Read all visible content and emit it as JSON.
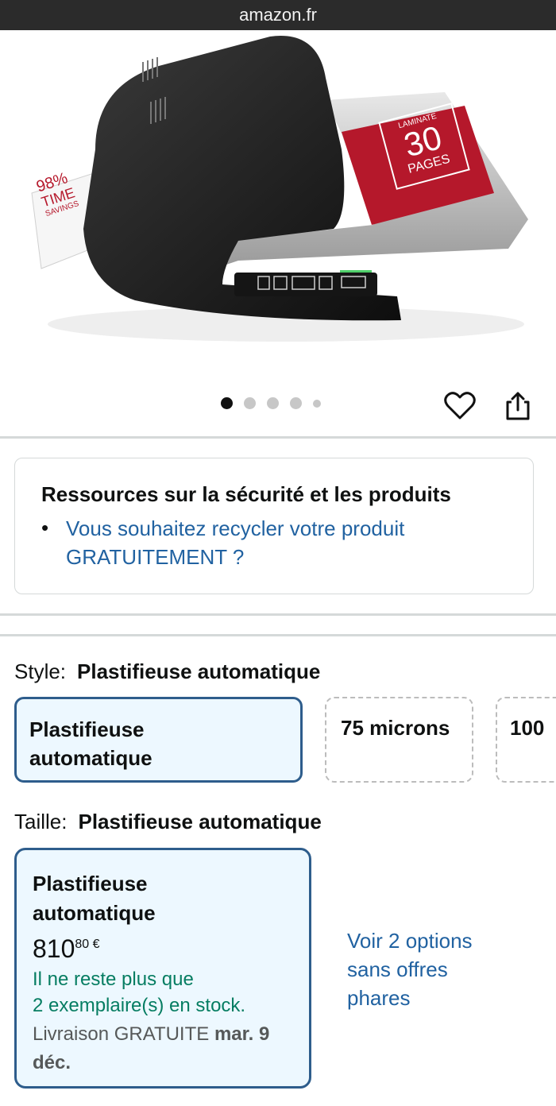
{
  "browser": {
    "url": "amazon.fr"
  },
  "product_image": {
    "badge_left": [
      "98%",
      "TIME",
      "SAVINGS"
    ],
    "badge_right": {
      "top": "LAMINATE",
      "number": "30",
      "bottom": "PAGES"
    },
    "carousel_dots": 5,
    "active_dot": 1
  },
  "actions": {
    "favorite_icon": "heart-icon",
    "share_icon": "share-icon"
  },
  "safety": {
    "title": "Ressources sur la sécurité et les produits",
    "link_line1": "Vous souhaitez recycler votre produit",
    "link_line2": "GRATUITEMENT ?"
  },
  "style": {
    "label": "Style:",
    "selected": "Plastifieuse automatique",
    "options": [
      {
        "line1": "Plastifieuse",
        "line2": "automatique"
      },
      {
        "line1": "75 microns"
      },
      {
        "line1": "100"
      }
    ]
  },
  "size": {
    "label": "Taille:",
    "selected": "Plastifieuse automatique",
    "card": {
      "name_line1": "Plastifieuse",
      "name_line2": "automatique",
      "price_whole": "810",
      "price_fraction": "80",
      "currency": "€",
      "stock_line1": "Il ne reste plus que",
      "stock_line2": "2 exemplaire(s) en stock.",
      "delivery_prefix": "Livraison GRATUITE",
      "delivery_date_line1": "mar. 9",
      "delivery_date_line2": "déc."
    },
    "other_options": [
      "Voir 2 options",
      "sans offres",
      "phares"
    ]
  },
  "colors": {
    "link": "#2162a1",
    "stock": "#067d62",
    "selected_border": "#2e5d8c",
    "selected_bg": "#edf8ff",
    "badge_red": "#b5182b"
  }
}
